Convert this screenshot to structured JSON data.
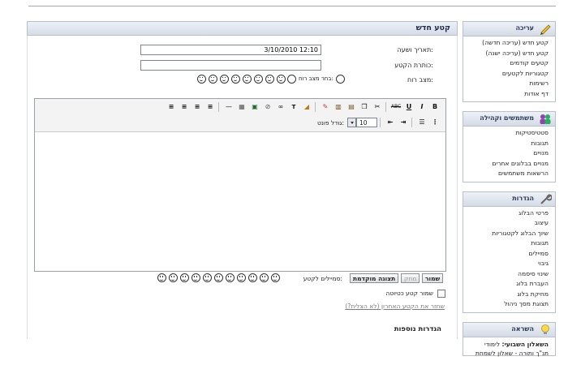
{
  "page": {
    "title": "קטע חדש"
  },
  "form": {
    "datetime_label": "תאריך ושעה:",
    "datetime_value": "3/10/2010 12:10",
    "title_label": "כותרת הקטע:",
    "title_value": "",
    "mood_label": "מצב רוח:",
    "mood_choose_label": "בחר מצב רוח:",
    "moods": [
      "cool-smiley",
      "cool-smiley",
      "surprised-smiley",
      "happy-smiley",
      "smile-smiley",
      "sad-smiley",
      "laugh-smiley",
      "grin-smiley"
    ]
  },
  "editor": {
    "toolbar_row1": [
      "B",
      "I",
      "U",
      "ABC",
      "✂",
      "⎘",
      "📋",
      "📝",
      "✏",
      "",
      "Tᵦ",
      "🔗",
      "⛓",
      "🖼",
      "▦",
      "—",
      "≡",
      "≡",
      "≡",
      "≡"
    ],
    "font_size_label": "גודל פונט:",
    "font_size_value": "10"
  },
  "actions": {
    "save": "שמור",
    "delete": "מחק",
    "preview": "תצוגה מוקדמת",
    "smilies_label": "סמיילים לקטע:",
    "save_as_draft": "שמור קטע כטיוטה",
    "restore_link": "שחזר את הקטע האחרון (לא הצליח?)",
    "more_settings": "הגדרות נוספות"
  },
  "sidebar": {
    "boxes": [
      {
        "title": "עריכה",
        "icon": "pencil-icon",
        "items": [
          "קטע חדש (עריכה חדשה)",
          "קטע חדש (עריכה ישנה)",
          "קטעים קודמים",
          "קטגוריות לקטעים",
          "רשימות",
          "דף אודות"
        ]
      },
      {
        "title": "משתמשים וקהילה",
        "icon": "users-icon",
        "items": [
          "סטטיסטיקות",
          "תגובות",
          "מנויים",
          "מנויים בבלוגים אחרים",
          "הרשאות משתמשים"
        ]
      },
      {
        "title": "הגדרות",
        "icon": "wrench-icon",
        "items": [
          "פרטי הבלוג",
          "עיצוב",
          "שיוך הבלוג לקטגוריות",
          "תגובות",
          "סמיילים",
          "גיבוי",
          "שינוי סיסמה",
          "העברת בלוג",
          "מחיקת בלוג",
          "תצוגת מסך ניהול"
        ]
      },
      {
        "title": "השראה",
        "icon": "lightbulb-icon",
        "tip_bold": "השאלון השבועי:",
        "tip_text": "לימודי תנ\"ך ותורה - שאלון לשמחת"
      }
    ]
  },
  "colors": {
    "header_bg": "#d6dde8",
    "border": "#b9c0cc",
    "title_text": "#1f2a44"
  }
}
